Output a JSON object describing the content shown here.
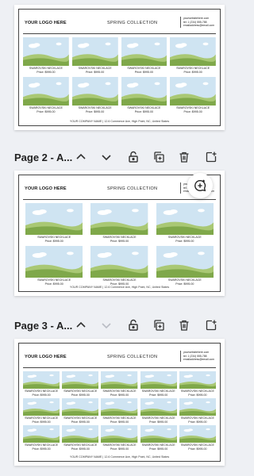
{
  "template": {
    "logo": "YOUR LOGO HERE",
    "collection": "SPRING COLLECTION",
    "contact_lines": [
      "yourwebsitehere.com",
      "tel: 1 (234) 555-788",
      "emailaddress@email.com"
    ],
    "product_name": "SWAROVSKI NECKLACE",
    "product_price": "Price: $995.00",
    "footer": "YOUR COMPANY NAME | 12.6 Commerce Ave, High Point, NC, United States"
  },
  "pages": [
    {
      "label": "Page 2 - A..."
    },
    {
      "label": "Page 3 - A..."
    }
  ],
  "toolbar": {
    "icons": [
      "chevron-up-icon",
      "chevron-down-icon",
      "unlock-icon",
      "duplicate-page-icon",
      "trash-icon",
      "add-page-icon"
    ]
  },
  "colors": {
    "sky": "#cfe4f2",
    "grass": "#7fa84a",
    "grass_light": "#a9c874"
  }
}
